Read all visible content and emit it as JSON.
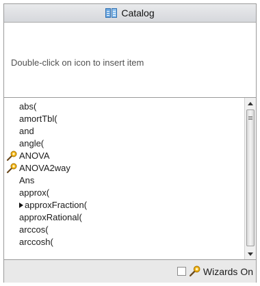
{
  "title": "Catalog",
  "info_text": "Double-click on icon to insert item",
  "items": [
    {
      "label": "abs(",
      "wizard": false,
      "submenu": false
    },
    {
      "label": "amortTbl(",
      "wizard": false,
      "submenu": false
    },
    {
      "label": "and",
      "wizard": false,
      "submenu": false
    },
    {
      "label": "angle(",
      "wizard": false,
      "submenu": false
    },
    {
      "label": "ANOVA",
      "wizard": true,
      "submenu": false
    },
    {
      "label": "ANOVA2way",
      "wizard": true,
      "submenu": false
    },
    {
      "label": "Ans",
      "wizard": false,
      "submenu": false
    },
    {
      "label": "approx(",
      "wizard": false,
      "submenu": false
    },
    {
      "label": "approxFraction(",
      "wizard": false,
      "submenu": true
    },
    {
      "label": "approxRational(",
      "wizard": false,
      "submenu": false
    },
    {
      "label": "arccos(",
      "wizard": false,
      "submenu": false
    },
    {
      "label": "arccosh(",
      "wizard": false,
      "submenu": false
    }
  ],
  "footer": {
    "wizards_label": "Wizards On",
    "wizards_checked": false
  },
  "icons": {
    "title": "catalog-book-icon",
    "wizard": "wizard-wand-icon",
    "submenu": "submenu-triangle-icon"
  }
}
